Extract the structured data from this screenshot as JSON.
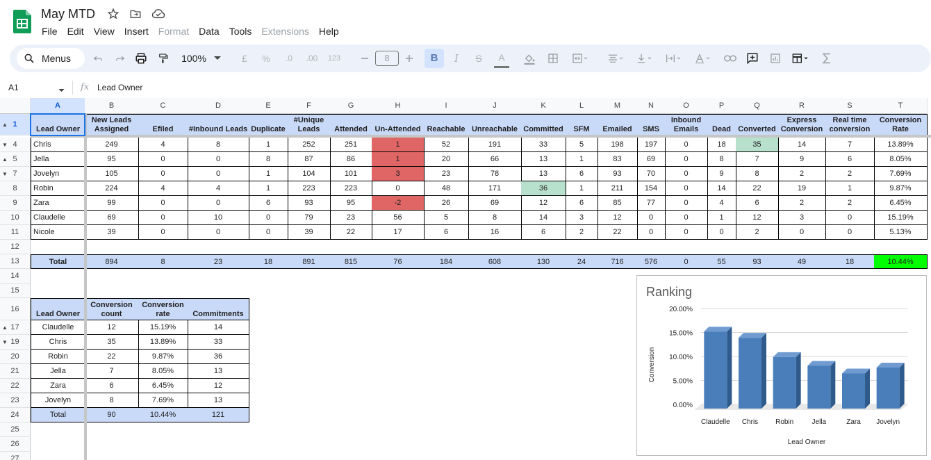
{
  "doc": {
    "title": "May MTD"
  },
  "menu": [
    "File",
    "Edit",
    "View",
    "Insert",
    "Format",
    "Data",
    "Tools",
    "Extensions",
    "Help"
  ],
  "menu_dim": [
    "Format",
    "Extensions"
  ],
  "toolbar": {
    "search_label": "Menus",
    "zoom": "100%",
    "currency": "£",
    "percent": "%",
    "decimals_dec": ".0",
    "decimals_inc": ".00",
    "number_format": "123",
    "font_size": "8",
    "bold": "B",
    "italic": "I",
    "strike": "S",
    "text_color": "A"
  },
  "formula_bar": {
    "cell_ref": "A1",
    "fx": "fx",
    "content": "Lead Owner"
  },
  "colors": {
    "header_fill": "#c9daf8",
    "red_fill": "#e06666",
    "green_fill": "#b7e1cd",
    "lime_fill": "#00ff00",
    "chart_bar": "#4a7ebb"
  },
  "columns": [
    "A",
    "B",
    "C",
    "D",
    "E",
    "F",
    "G",
    "H",
    "I",
    "J",
    "K",
    "L",
    "M",
    "N",
    "O",
    "P",
    "Q",
    "R",
    "S",
    "T"
  ],
  "row_numbers": [
    "1",
    "4",
    "5",
    "7",
    "8",
    "9",
    "10",
    "11",
    "12",
    "13",
    "14",
    "15",
    "16",
    "17",
    "19",
    "20",
    "21",
    "22",
    "23",
    "24",
    "25",
    "26",
    "27"
  ],
  "main_table": {
    "headers": [
      "Lead Owner",
      "New Leads Assigned",
      "Efiled",
      "#Inbound Leads",
      "Duplicate",
      "#Unique Leads",
      "Attended",
      "Un-Attended",
      "Reachable",
      "Unreachable",
      "Committed",
      "SFM",
      "Emailed",
      "SMS",
      "Inbound Emails",
      "Dead",
      "Converted",
      "Express Conversion",
      "Real time conversion",
      "Conversion Rate"
    ],
    "rows": [
      [
        "Chris",
        "249",
        "4",
        "8",
        "1",
        "252",
        "251",
        "1",
        "52",
        "191",
        "33",
        "5",
        "198",
        "197",
        "0",
        "18",
        "35",
        "14",
        "7",
        "13.89%"
      ],
      [
        "Jella",
        "95",
        "0",
        "0",
        "8",
        "87",
        "86",
        "1",
        "20",
        "66",
        "13",
        "1",
        "83",
        "69",
        "0",
        "8",
        "7",
        "9",
        "6",
        "8.05%"
      ],
      [
        "Jovelyn",
        "105",
        "0",
        "0",
        "1",
        "104",
        "101",
        "3",
        "23",
        "78",
        "13",
        "6",
        "93",
        "70",
        "0",
        "9",
        "8",
        "2",
        "2",
        "7.69%"
      ],
      [
        "Robin",
        "224",
        "4",
        "4",
        "1",
        "223",
        "223",
        "0",
        "48",
        "171",
        "36",
        "1",
        "211",
        "154",
        "0",
        "14",
        "22",
        "19",
        "1",
        "9.87%"
      ],
      [
        "Zara",
        "99",
        "0",
        "0",
        "6",
        "93",
        "95",
        "-2",
        "26",
        "69",
        "12",
        "6",
        "85",
        "77",
        "0",
        "4",
        "6",
        "2",
        "2",
        "6.45%"
      ],
      [
        "Claudelle",
        "69",
        "0",
        "10",
        "0",
        "79",
        "23",
        "56",
        "5",
        "8",
        "14",
        "3",
        "12",
        "0",
        "0",
        "1",
        "12",
        "3",
        "0",
        "15.19%"
      ],
      [
        "Nicole",
        "39",
        "0",
        "0",
        "0",
        "39",
        "22",
        "17",
        "6",
        "16",
        "6",
        "2",
        "22",
        "0",
        "0",
        "0",
        "2",
        "0",
        "0",
        "5.13%"
      ]
    ],
    "total": [
      "Total",
      "894",
      "8",
      "23",
      "18",
      "891",
      "815",
      "76",
      "184",
      "608",
      "130",
      "24",
      "716",
      "576",
      "0",
      "55",
      "93",
      "49",
      "18",
      "10.44%"
    ]
  },
  "ranking_table": {
    "headers": [
      "Lead Owner",
      "Conversion count",
      "Conversion rate",
      "Commitments"
    ],
    "rows": [
      [
        "Claudelle",
        "12",
        "15.19%",
        "14"
      ],
      [
        "Chris",
        "35",
        "13.89%",
        "33"
      ],
      [
        "Robin",
        "22",
        "9.87%",
        "36"
      ],
      [
        "Jella",
        "7",
        "8.05%",
        "13"
      ],
      [
        "Zara",
        "6",
        "6.45%",
        "12"
      ],
      [
        "Jovelyn",
        "8",
        "7.69%",
        "13"
      ]
    ],
    "total": [
      "Total",
      "90",
      "10.44%",
      "121"
    ]
  },
  "chart_data": {
    "type": "bar",
    "title": "Ranking",
    "xlabel": "Lead Owner",
    "ylabel": "Conversion",
    "categories": [
      "Claudelle",
      "Chris",
      "Robin",
      "Jella",
      "Zara",
      "Jovelyn"
    ],
    "values": [
      15.19,
      13.89,
      9.87,
      8.05,
      6.45,
      7.69
    ],
    "ylim": [
      0,
      20
    ],
    "yticks": [
      "0.00%",
      "5.00%",
      "10.00%",
      "15.00%",
      "20.00%"
    ],
    "grid": true,
    "legend": "none",
    "style": "3d"
  }
}
